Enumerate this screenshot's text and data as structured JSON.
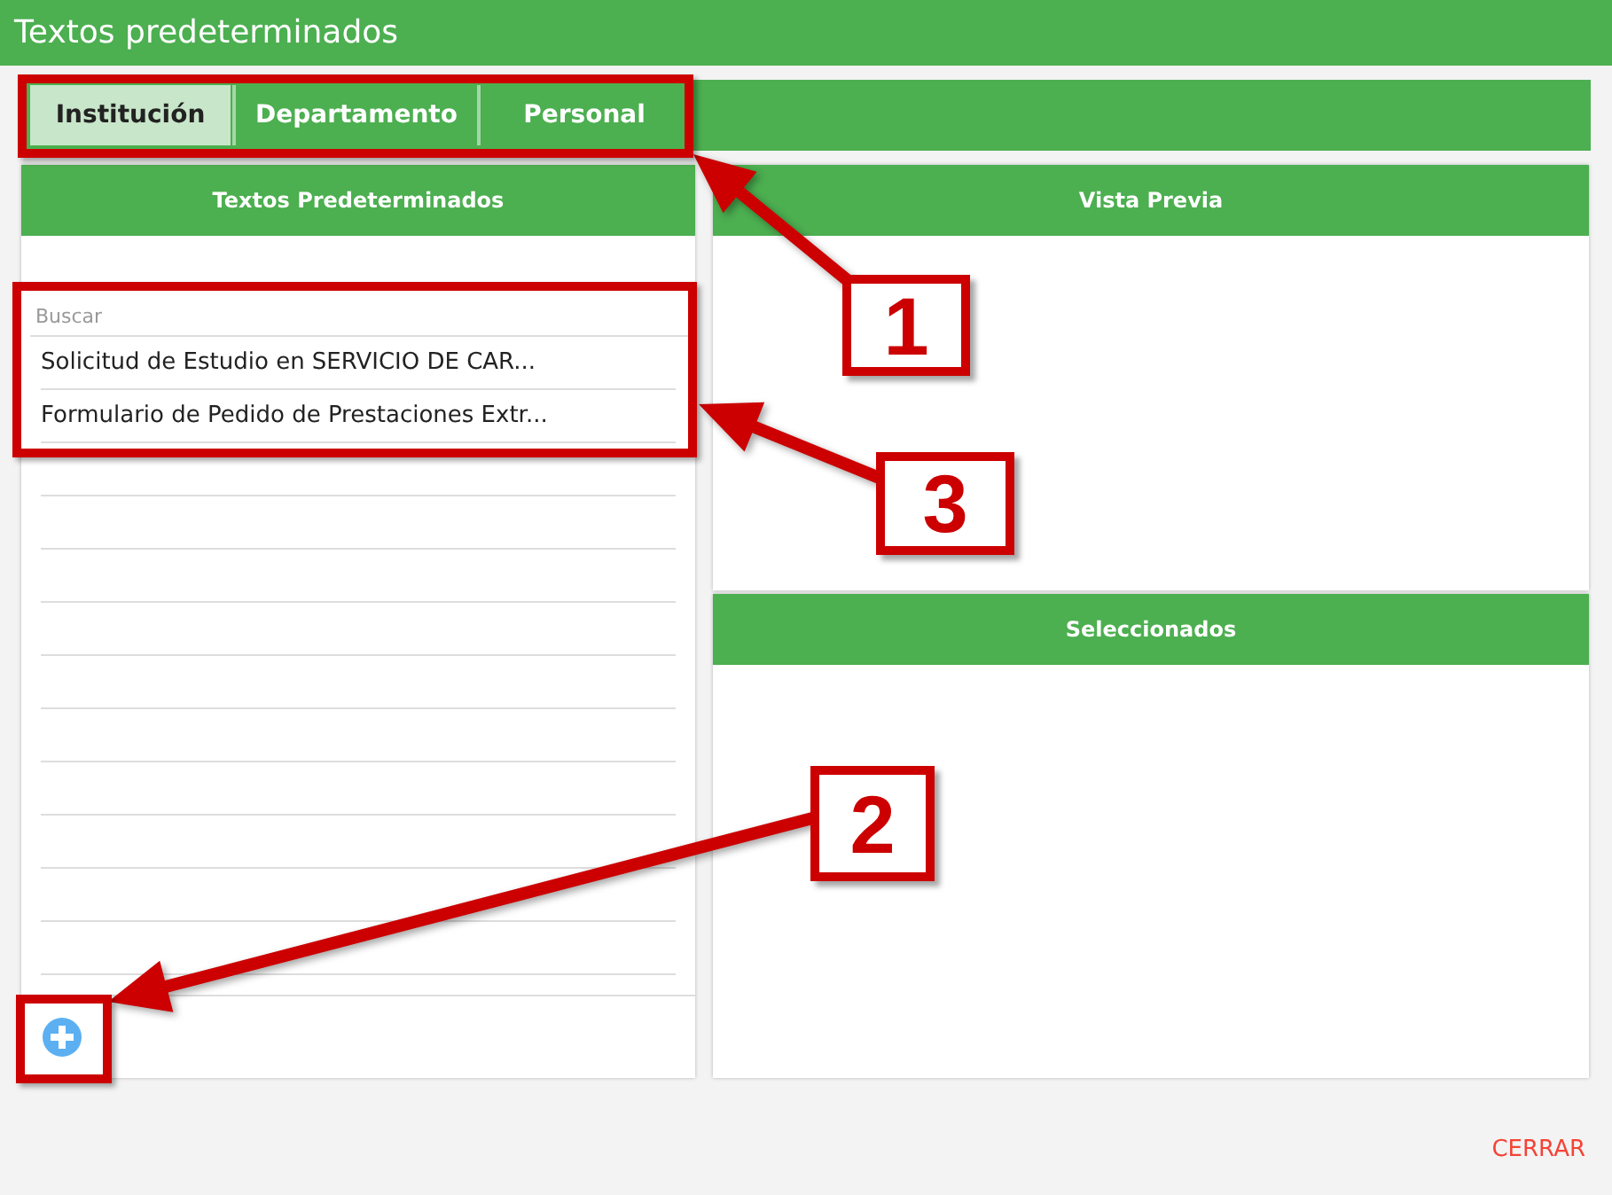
{
  "window": {
    "title": "Textos predeterminados"
  },
  "tabs": [
    {
      "label": "Institución",
      "selected": true
    },
    {
      "label": "Departamento",
      "selected": false
    },
    {
      "label": "Personal",
      "selected": false
    }
  ],
  "texts_panel": {
    "title": "Textos Predeterminados",
    "search": {
      "placeholder": "Buscar"
    },
    "items": [
      "Solicitud de Estudio en SERVICIO DE CAR...",
      "Formulario de Pedido de Prestaciones Extr..."
    ]
  },
  "preview_panel": {
    "title": "Vista Previa"
  },
  "selected_panel": {
    "title": "Seleccionados"
  },
  "close_button": {
    "label": "CERRAR"
  },
  "annotations": [
    {
      "label": "1"
    },
    {
      "label": "3"
    },
    {
      "label": "2"
    }
  ]
}
